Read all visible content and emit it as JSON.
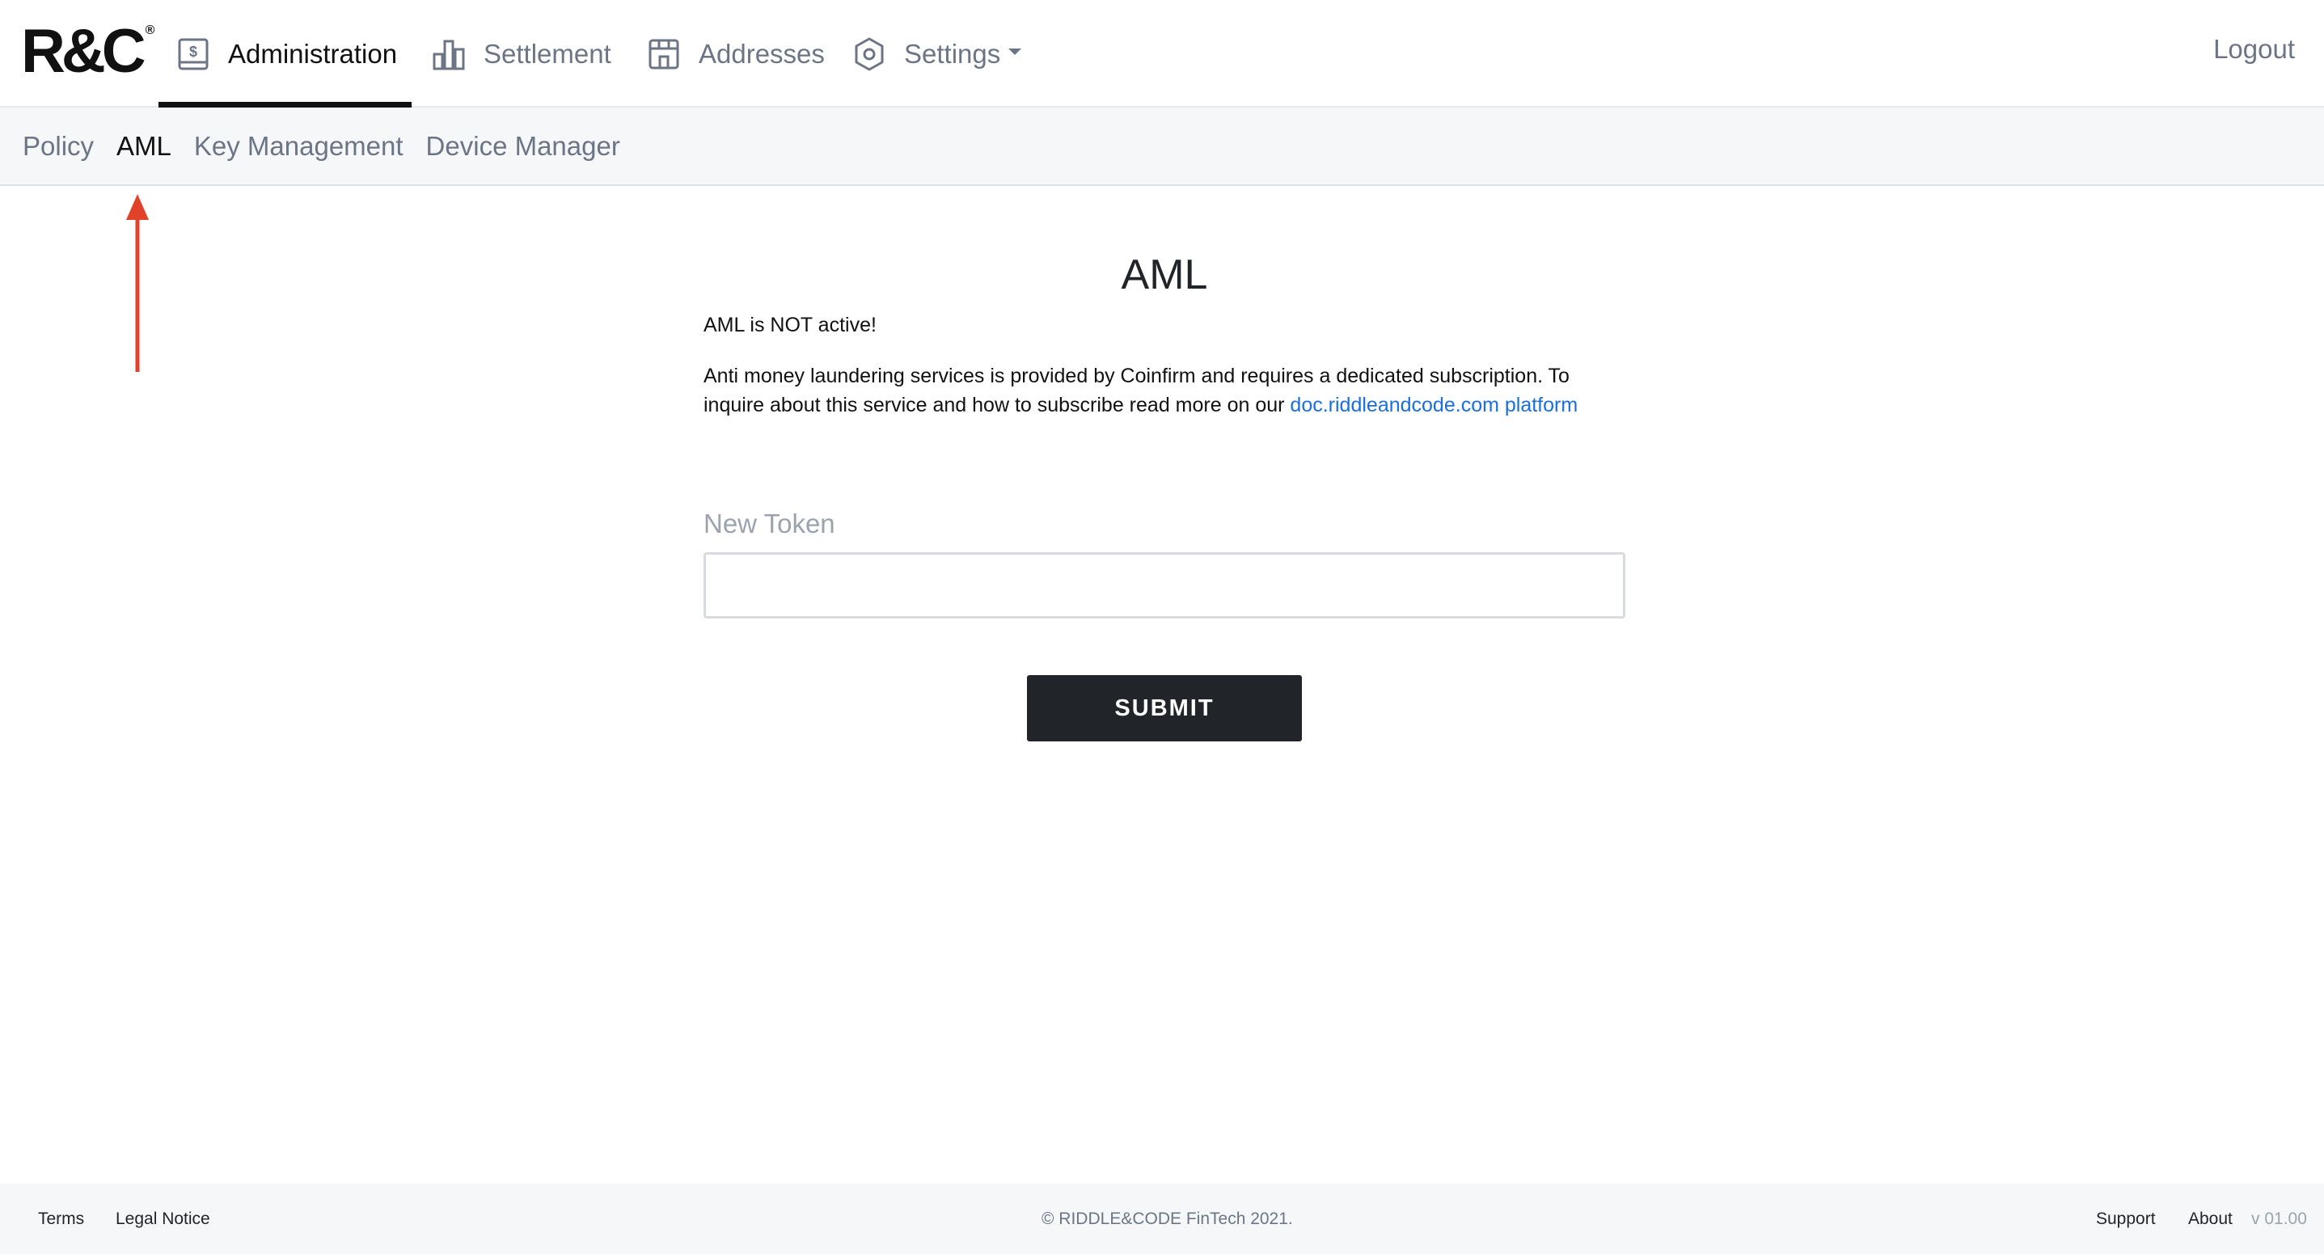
{
  "brand": {
    "logo_text": "R&C",
    "logo_mark": "®"
  },
  "nav": {
    "items": [
      {
        "label": "Administration",
        "icon": "dollar-document-icon",
        "active": true
      },
      {
        "label": "Settlement",
        "icon": "bar-chart-icon",
        "active": false
      },
      {
        "label": "Addresses",
        "icon": "storefront-icon",
        "active": false
      },
      {
        "label": "Settings",
        "icon": "gear-icon",
        "active": false,
        "dropdown": true
      }
    ],
    "logout_label": "Logout"
  },
  "subnav": {
    "items": [
      {
        "label": "Policy",
        "active": false
      },
      {
        "label": "AML",
        "active": true
      },
      {
        "label": "Key Management",
        "active": false
      },
      {
        "label": "Device Manager",
        "active": false
      }
    ]
  },
  "annotation": {
    "color": "#e2412a"
  },
  "main": {
    "title": "AML",
    "status_text": "AML is NOT active!",
    "description": "Anti money laundering services is provided by Coinfirm and requires a dedicated subscription. To inquire about this service and how to subscribe read more on our",
    "link_text": "doc.riddleandcode.com platform",
    "token_label": "New Token",
    "token_value": "",
    "submit_label": "SUBMIT"
  },
  "footer": {
    "terms": "Terms",
    "legal_notice": "Legal Notice",
    "copyright": "© RIDDLE&CODE FinTech 2021.",
    "support": "Support",
    "about": "About",
    "version": "v 01.00"
  },
  "colors": {
    "accent_dark": "#212529",
    "link": "#1a6fe0",
    "muted": "#6b7585",
    "annotation_arrow": "#e2412a"
  }
}
